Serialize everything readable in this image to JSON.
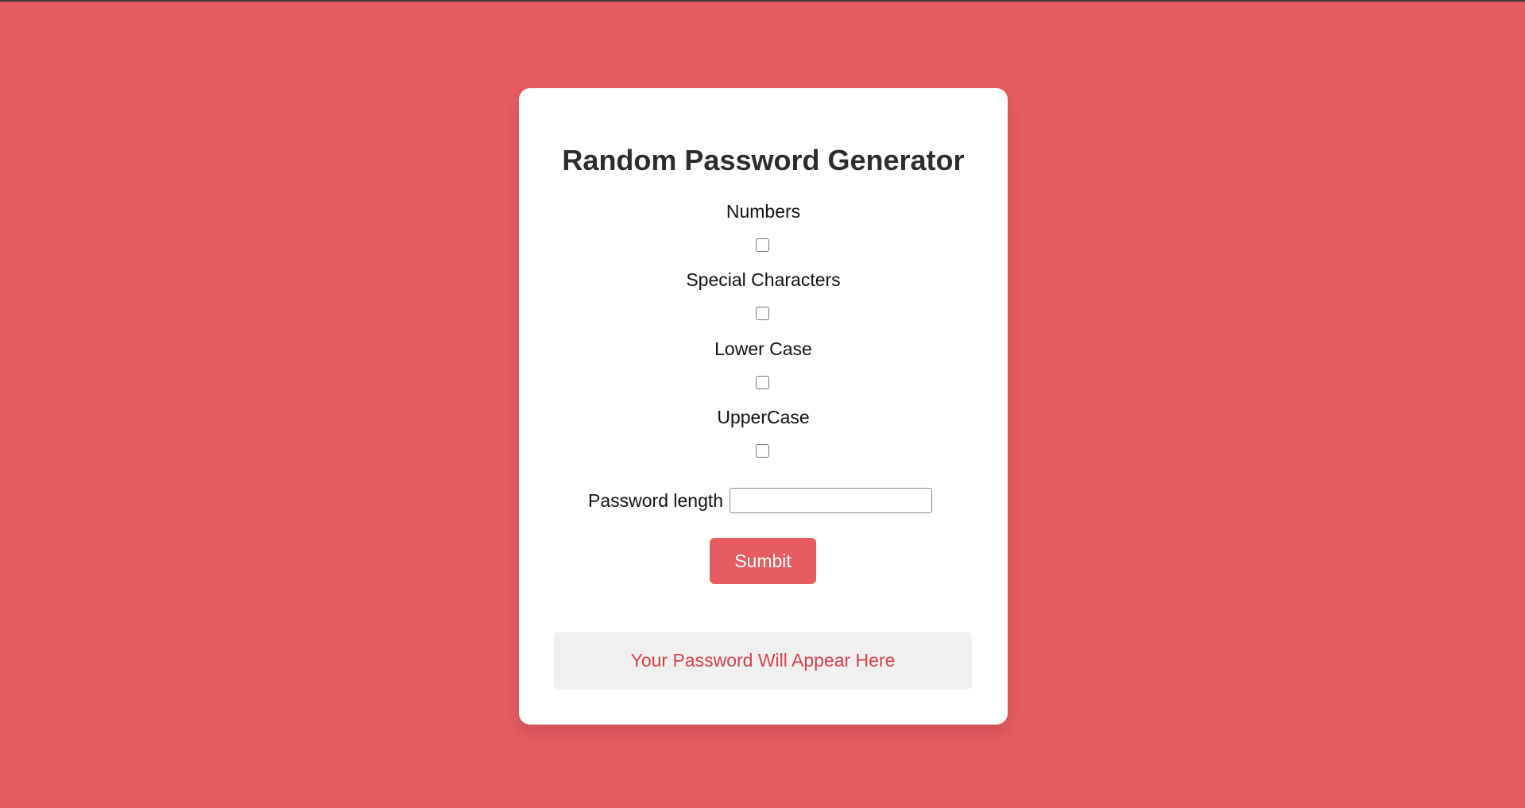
{
  "title": "Random Password Generator",
  "options": [
    {
      "label": "Numbers",
      "checked": false
    },
    {
      "label": "Special Characters",
      "checked": false
    },
    {
      "label": "Lower Case",
      "checked": false
    },
    {
      "label": "UpperCase",
      "checked": false
    }
  ],
  "length": {
    "label": "Password length",
    "value": ""
  },
  "submit_label": "Sumbit",
  "result_text": "Your Password Will Appear Here",
  "colors": {
    "background": "#e65c61",
    "card": "#ffffff",
    "button": "#e65c61",
    "result_text": "#d64049",
    "result_bg": "#f0f0f0"
  }
}
